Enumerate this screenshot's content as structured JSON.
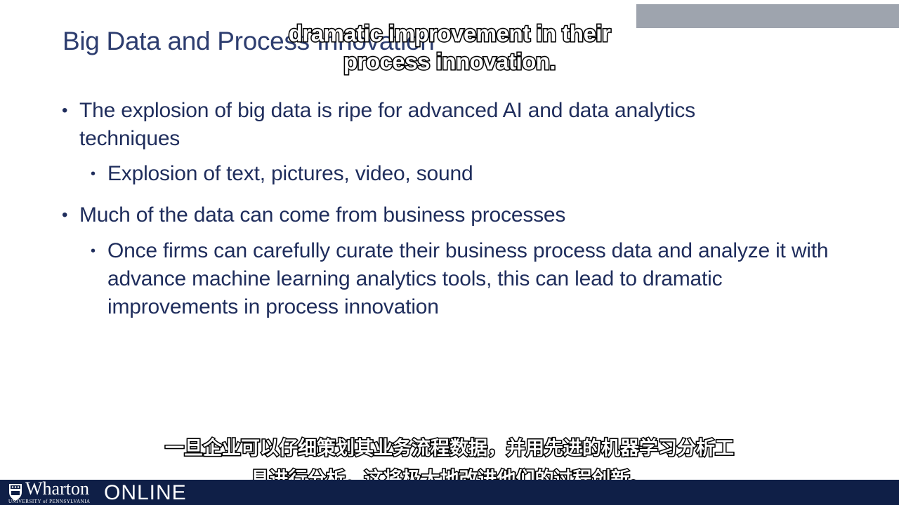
{
  "slide": {
    "title": "Big Data and Process Innovation",
    "bullets": [
      {
        "text": "The explosion of big data is ripe for advanced AI and data analytics techniques",
        "sub": "Explosion of text, pictures, video, sound"
      },
      {
        "text": "Much of the data can come from business processes",
        "sub": "Once firms can carefully curate their business process data and analyze it with advance machine learning analytics tools, this can lead to dramatic improvements in process innovation"
      }
    ],
    "bullet_glyph": "•"
  },
  "captions": {
    "english": "dramatic improvement in their process innovation.",
    "chinese_line1": "一旦企业可以仔细策划其业务流程数据，并用先进的机器学习分析工",
    "chinese_line2": "具进行分析，这将极大地改进他们的过程创新。"
  },
  "footer": {
    "logo_wordmark": "Wharton",
    "logo_sub": "UNIVERSITY of PENNSYLVANIA",
    "logo_online": "ONLINE",
    "logo_icon": "penn-shield-icon"
  },
  "colors": {
    "title": "#2d3d6f",
    "body_text": "#1f2d5c",
    "footer_bg": "#0f1f47",
    "corner_box": "#9ea4ae"
  }
}
